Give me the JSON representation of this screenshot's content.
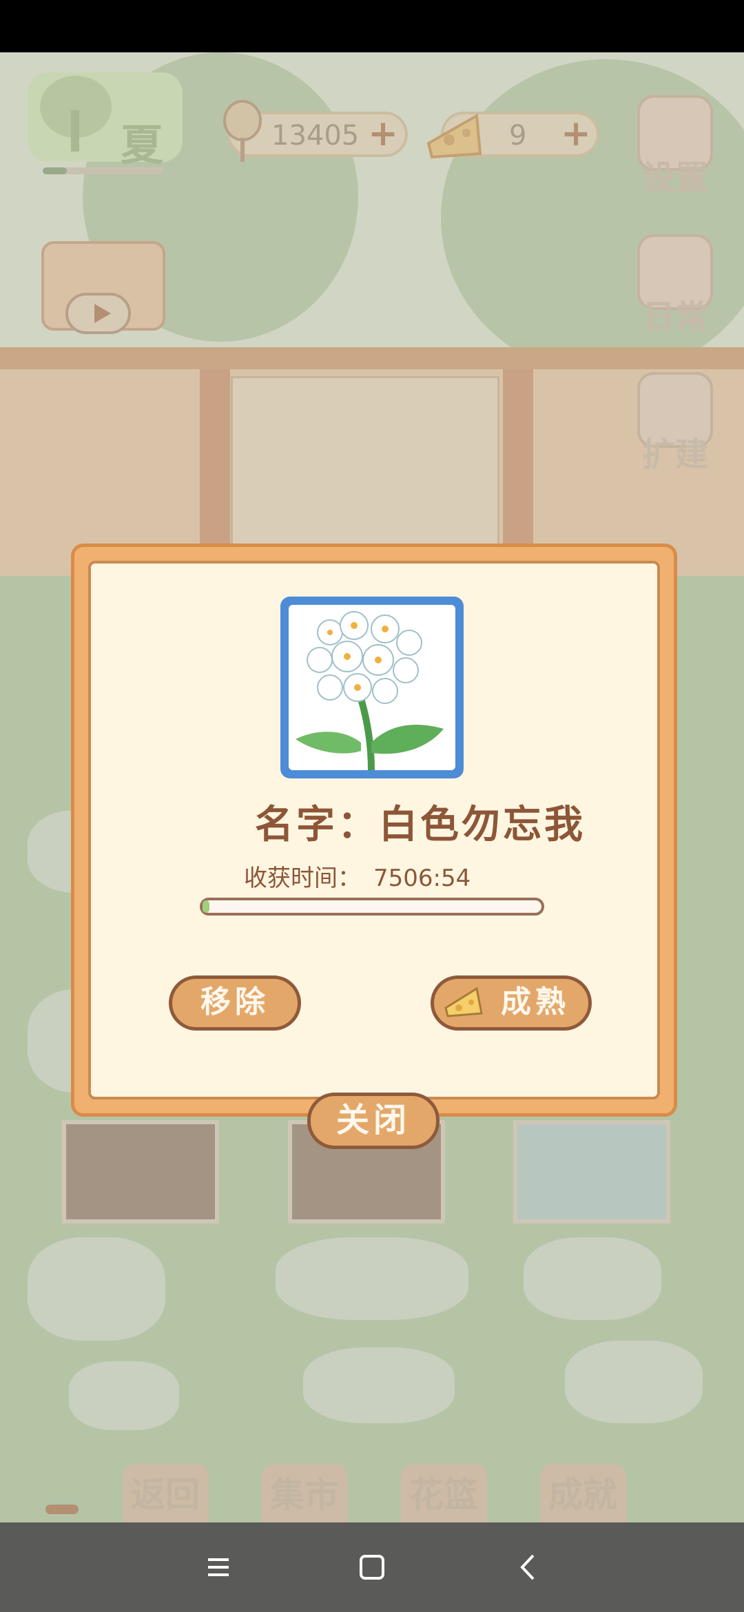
{
  "hud": {
    "season_label": "夏",
    "season_progress": 0.2,
    "fish_currency": "13405",
    "cheese_currency": "9",
    "settings_label": "设置",
    "daily_label": "日常",
    "expand_label": "扩建"
  },
  "bottom_nav": {
    "back_label": "返回",
    "market_label": "集市",
    "basket_label": "花篮",
    "achievement_label": "成就"
  },
  "modal": {
    "name_prefix": "名字：",
    "flower_name": "白色勿忘我",
    "harvest_label": "收获时间：",
    "harvest_time": "7506:54",
    "progress": 0.02,
    "remove_button": "移除",
    "mature_button": "成熟",
    "close_button": "关闭"
  },
  "colors": {
    "modal_border": "#f0b070",
    "button_fill": "#e3a869",
    "text_brown": "#8c5637",
    "flower_frame": "#4d8cd6"
  },
  "system_nav": {
    "icons": [
      "menu-icon",
      "home-icon",
      "back-icon"
    ]
  }
}
